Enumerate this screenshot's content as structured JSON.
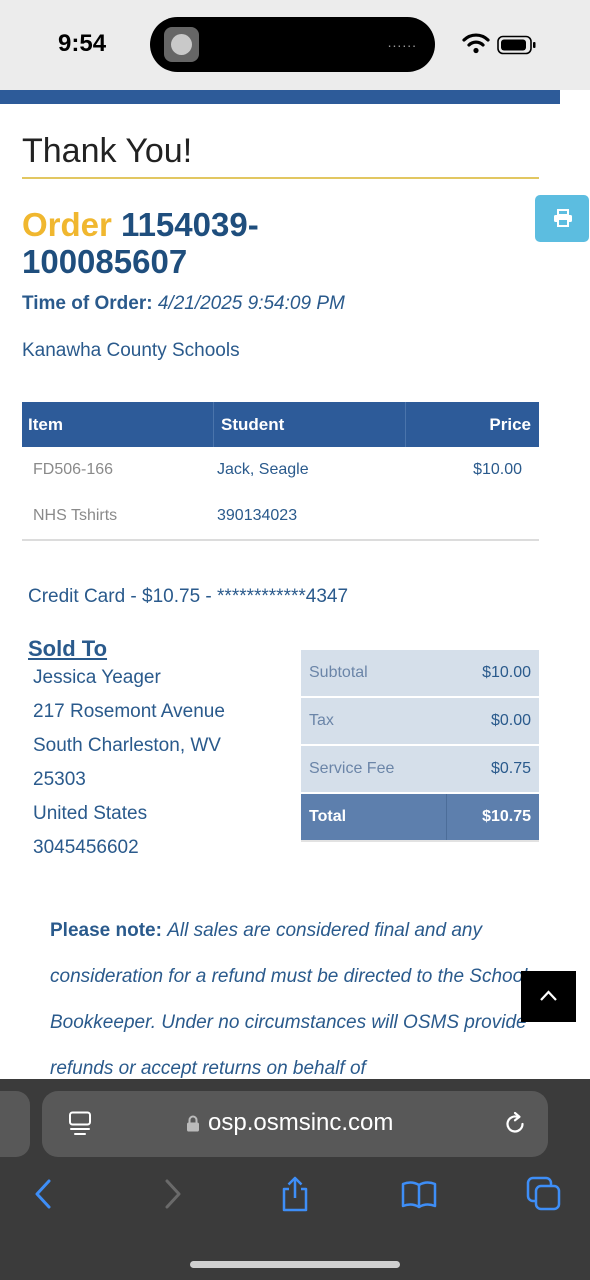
{
  "status_bar": {
    "time": "9:54",
    "island_dots": "......"
  },
  "page": {
    "title": "Thank You!"
  },
  "order": {
    "label": "Order",
    "number_line1": "1154039-",
    "number_line2": "100085607",
    "time_label": "Time of Order:",
    "time_value": "4/21/2025 9:54:09 PM",
    "school": "Kanawha County Schools"
  },
  "items_table": {
    "headers": {
      "item": "Item",
      "student": "Student",
      "price": "Price"
    },
    "rows": [
      {
        "item": "FD506-166",
        "student": "Jack, Seagle",
        "price": "$10.00"
      },
      {
        "item": "NHS Tshirts",
        "student": "390134023",
        "price": ""
      }
    ]
  },
  "payment": {
    "line": "Credit Card - $10.75 - ************4347"
  },
  "sold_to": {
    "heading": "Sold To",
    "lines": [
      "Jessica Yeager",
      "217 Rosemont Avenue",
      "South Charleston, WV",
      "25303",
      "United States",
      "3045456602"
    ]
  },
  "totals": {
    "rows": [
      {
        "label": "Subtotal",
        "value": "$10.00"
      },
      {
        "label": "Tax",
        "value": "$0.00"
      },
      {
        "label": "Service Fee",
        "value": "$0.75"
      }
    ],
    "total": {
      "label": "Total",
      "value": "$10.75"
    }
  },
  "note": {
    "label": "Please note:",
    "body": "All sales are considered final and any consideration for a refund must be directed to the School Bookkeeper. Under no circumstances will OSMS provide refunds or accept returns on behalf of"
  },
  "browser": {
    "url": "osp.osmsinc.com"
  },
  "colors": {
    "brand_blue": "#2d5b99",
    "accent_gold": "#f0b72f",
    "print_button": "#5cbde0",
    "text_blue": "#2a5a8c"
  },
  "icons": [
    "wifi-icon",
    "battery-icon",
    "print-icon",
    "chevron-up-icon",
    "tabs-icon",
    "lock-icon",
    "reload-icon",
    "back-icon",
    "forward-icon",
    "share-icon",
    "bookmarks-icon",
    "tab-overview-icon"
  ]
}
